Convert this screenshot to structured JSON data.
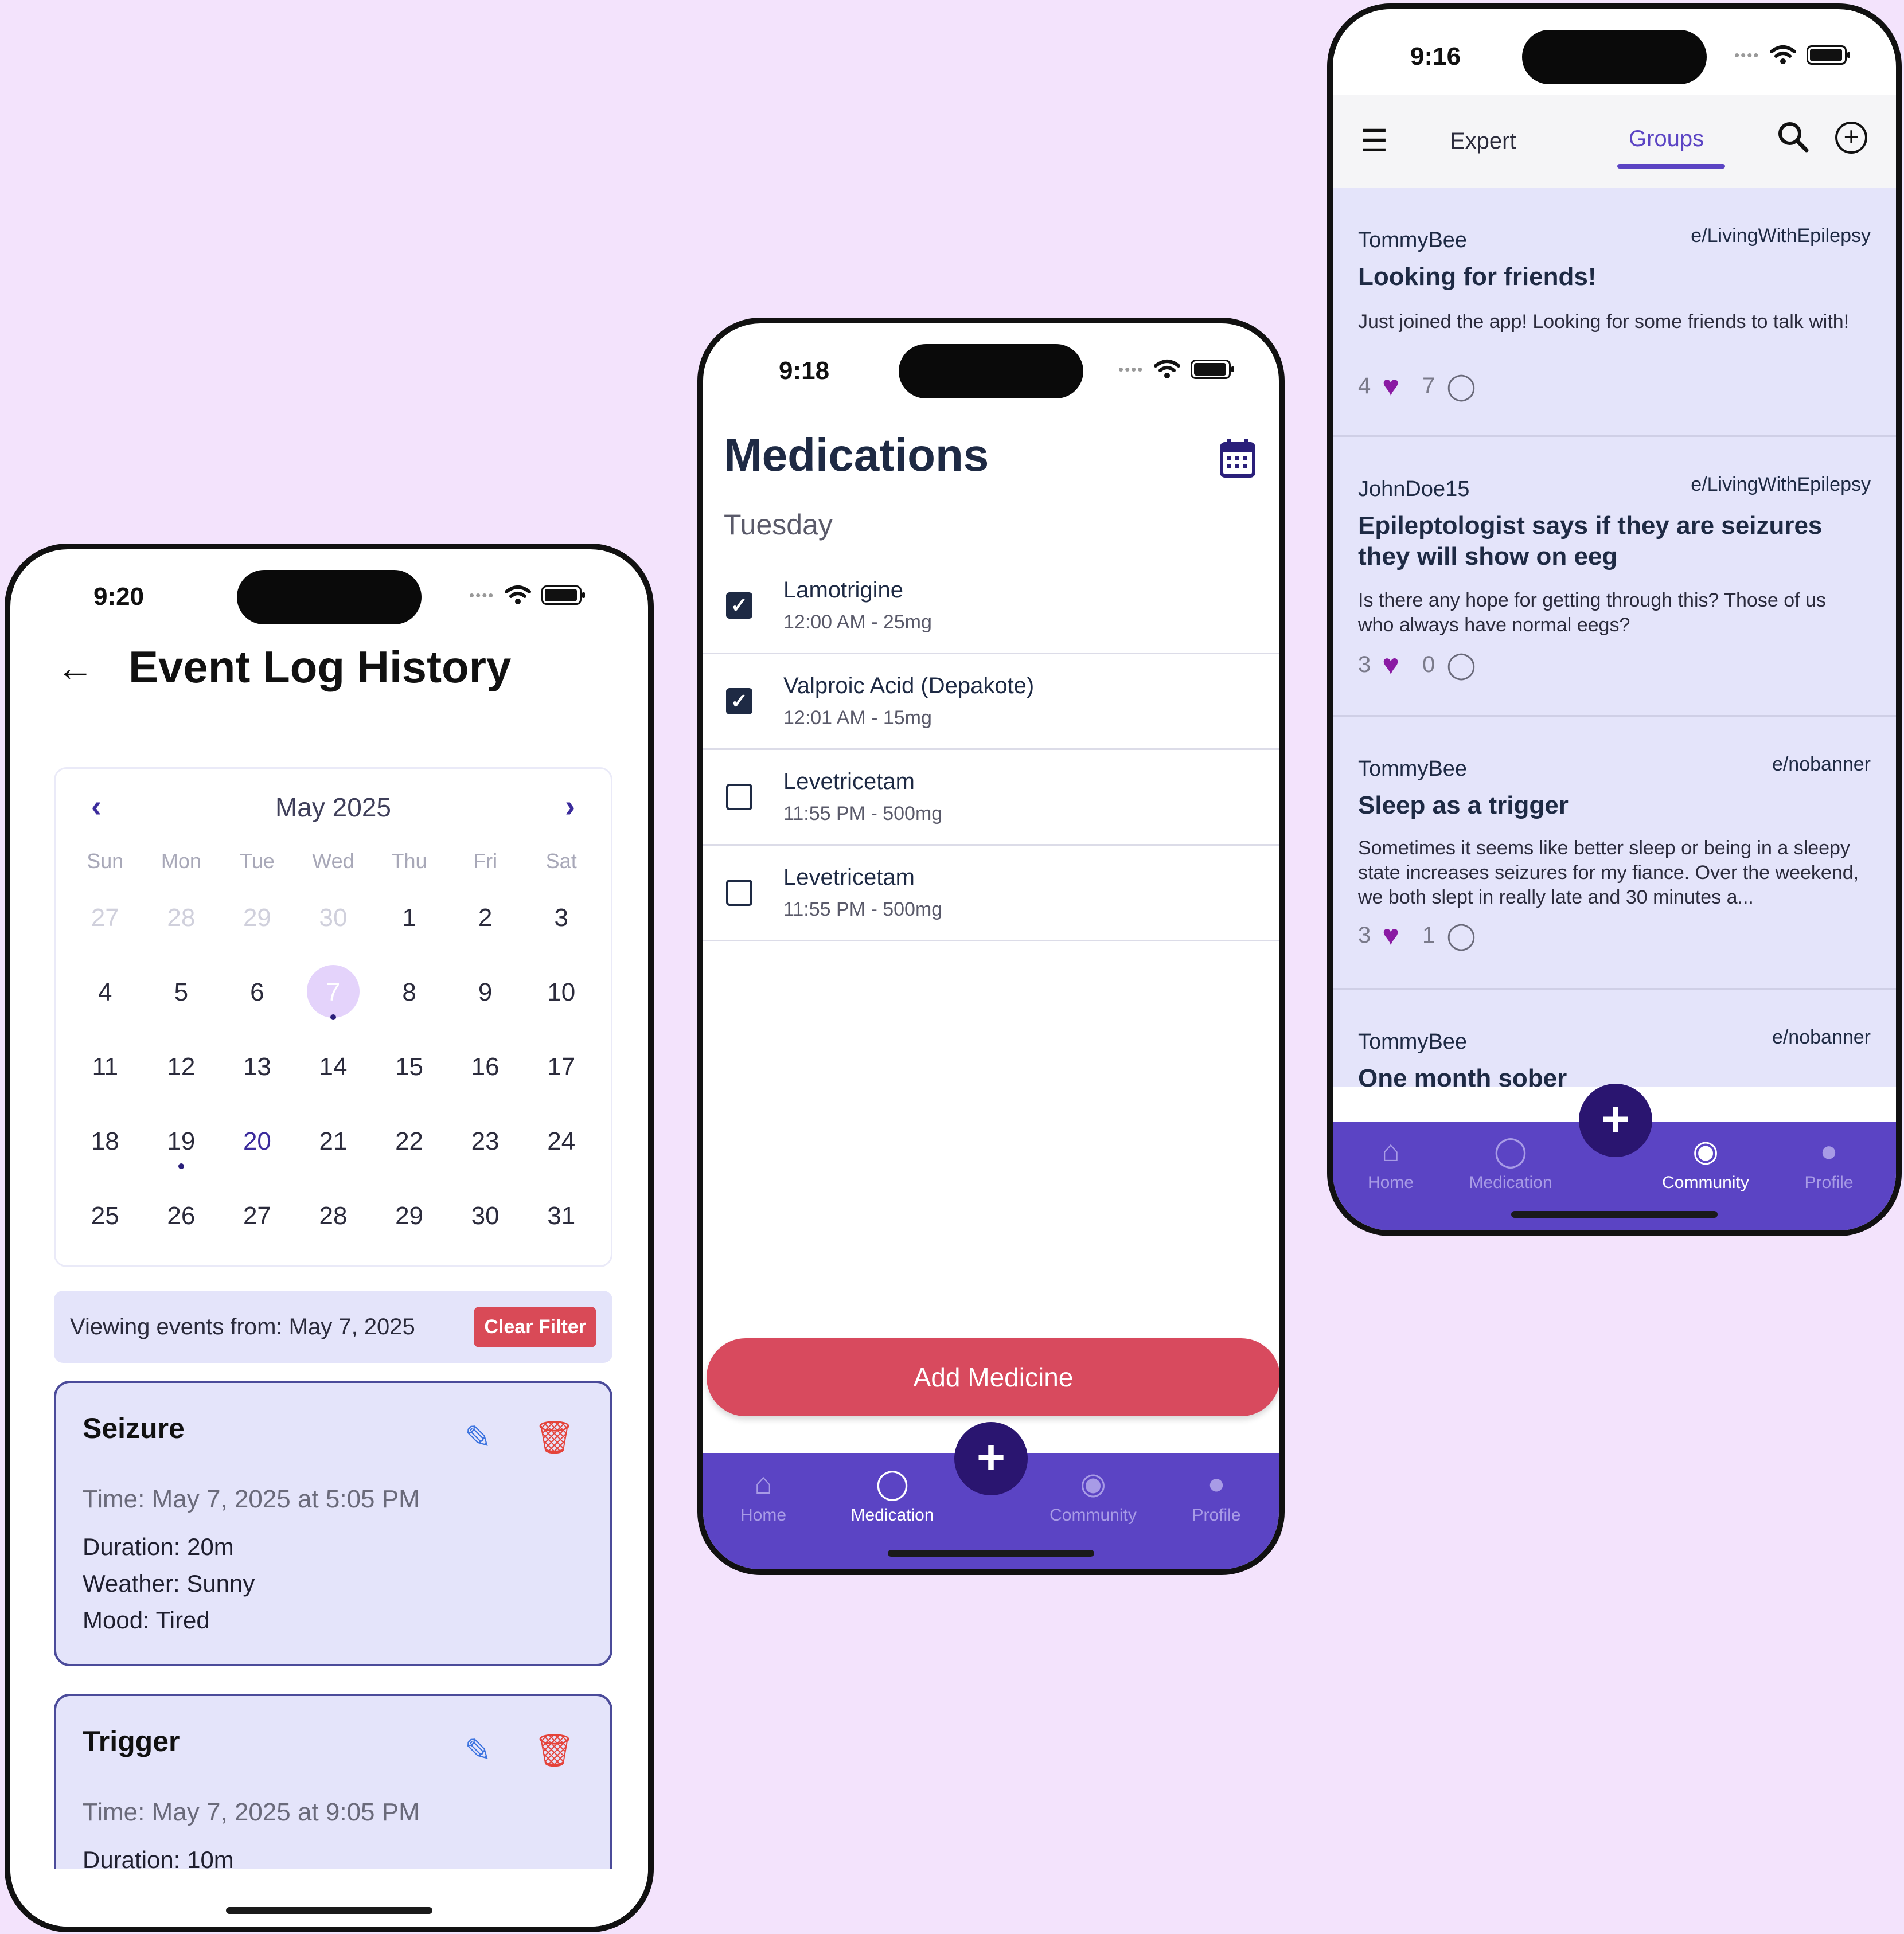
{
  "phone1": {
    "status_time": "9:20",
    "title": "Event Log History",
    "calendar": {
      "month": "May 2025",
      "weekdays": [
        "Sun",
        "Mon",
        "Tue",
        "Wed",
        "Thu",
        "Fri",
        "Sat"
      ],
      "days": [
        "27",
        "28",
        "29",
        "30",
        "1",
        "2",
        "3",
        "4",
        "5",
        "6",
        "7",
        "8",
        "9",
        "10",
        "11",
        "12",
        "13",
        "14",
        "15",
        "16",
        "17",
        "18",
        "19",
        "20",
        "21",
        "22",
        "23",
        "24",
        "25",
        "26",
        "27",
        "28",
        "29",
        "30",
        "31"
      ],
      "selected_day": "7",
      "today_day": "20"
    },
    "filter": {
      "text": "Viewing events from: May 7, 2025",
      "clear_label": "Clear Filter"
    },
    "events": [
      {
        "type": "Seizure",
        "time": "Time: May 7, 2025 at 5:05 PM",
        "duration": "Duration: 20m",
        "weather": "Weather: Sunny",
        "mood": "Mood: Tired"
      },
      {
        "type": "Trigger",
        "time": "Time: May 7, 2025 at 9:05 PM",
        "duration": "Duration: 10m"
      }
    ]
  },
  "phone2": {
    "status_time": "9:18",
    "title": "Medications",
    "day": "Tuesday",
    "meds": [
      {
        "name": "Lamotrigine",
        "dose": "12:00 AM - 25mg",
        "checked": true
      },
      {
        "name": "Valproic Acid (Depakote)",
        "dose": "12:01 AM - 15mg",
        "checked": true
      },
      {
        "name": "Levetricetam",
        "dose": "11:55 PM - 500mg",
        "checked": false
      },
      {
        "name": "Levetricetam",
        "dose": "11:55 PM - 500mg",
        "checked": false
      }
    ],
    "add_label": "Add Medicine",
    "tabs": [
      "Home",
      "Medication",
      "Community",
      "Profile"
    ],
    "active_tab": "Medication"
  },
  "phone3": {
    "status_time": "9:16",
    "tab_expert": "Expert",
    "tab_groups": "Groups",
    "posts": [
      {
        "user": "TommyBee",
        "group": "e/LivingWithEpilepsy",
        "title": "Looking for friends!",
        "body": "Just joined the app! Looking for some friends to talk with!",
        "likes": "4",
        "comments": "7"
      },
      {
        "user": "JohnDoe15",
        "group": "e/LivingWithEpilepsy",
        "title": "Epileptologist says if they are seizures they will show on eeg",
        "body": "Is there any hope for getting through this? Those of us who always have normal eegs?",
        "likes": "3",
        "comments": "0"
      },
      {
        "user": "TommyBee",
        "group": "e/nobanner",
        "title": "Sleep as a trigger",
        "body": "Sometimes it seems like better sleep or being in a sleepy state increases seizures for my fiance. Over the weekend, we both slept in really late and 30 minutes a...",
        "likes": "3",
        "comments": "1"
      },
      {
        "user": "TommyBee",
        "group": "e/nobanner",
        "title": "One month sober"
      }
    ],
    "tabs": [
      "Home",
      "Medication",
      "Community",
      "Profile"
    ],
    "active_tab": "Community"
  },
  "icons": {
    "back": "arrow-left-icon",
    "prev": "chevron-left-icon",
    "next": "chevron-right-icon",
    "edit": "pencil-icon",
    "delete": "trash-icon",
    "calendar": "calendar-icon",
    "menu": "hamburger-icon",
    "search": "search-icon",
    "add": "plus-circle-icon",
    "like": "heart-icon",
    "comment": "comment-icon"
  },
  "colors": {
    "background": "#f3e3fc",
    "accent": "#5b44c4",
    "fab": "#2a1570",
    "danger": "#d84a5e",
    "card": "#e4e4fa"
  }
}
